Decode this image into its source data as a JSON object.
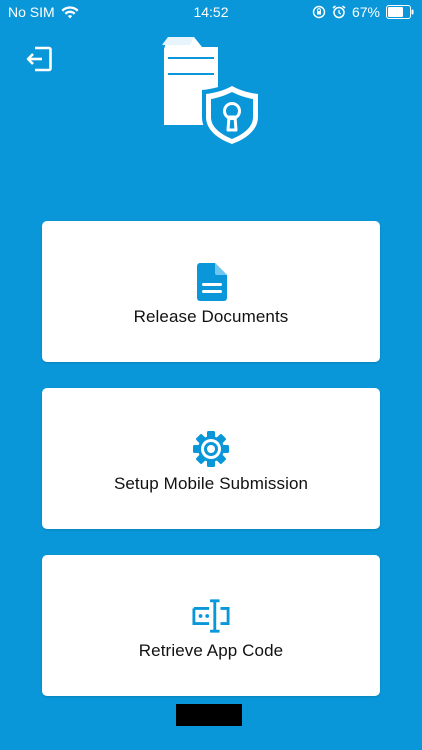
{
  "status_bar": {
    "carrier": "No SIM",
    "time": "14:52",
    "battery": "67%"
  },
  "icons": {
    "wifi": "wifi-icon",
    "lock_rotation": "orientation-lock-icon",
    "alarm": "alarm-icon",
    "battery": "battery-icon",
    "exit": "exit-icon",
    "logo": "printer-shield-lock-icon",
    "document": "document-icon",
    "gear": "gear-icon",
    "code": "text-cursor-code-icon"
  },
  "colors": {
    "background": "#0a97d9",
    "card": "#ffffff",
    "accent": "#0a97d9",
    "text": "#111111"
  },
  "menu": [
    {
      "label": "Release Documents",
      "icon": "document-icon"
    },
    {
      "label": "Setup Mobile Submission",
      "icon": "gear-icon"
    },
    {
      "label": "Retrieve App Code",
      "icon": "text-cursor-code-icon"
    }
  ]
}
